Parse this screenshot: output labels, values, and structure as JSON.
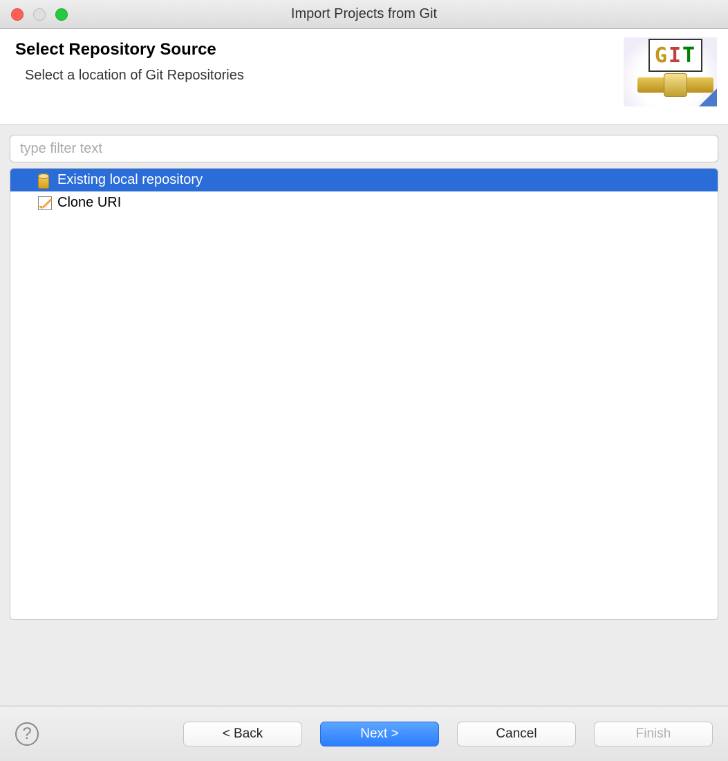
{
  "window": {
    "title": "Import Projects from Git"
  },
  "header": {
    "title": "Select Repository Source",
    "subtitle": "Select a location of Git Repositories"
  },
  "filter": {
    "placeholder": "type filter text",
    "value": ""
  },
  "options": [
    {
      "label": "Existing local repository",
      "selected": true,
      "icon": "database-icon"
    },
    {
      "label": "Clone URI",
      "selected": false,
      "icon": "edit-note-icon"
    }
  ],
  "footer": {
    "back": "< Back",
    "next": "Next >",
    "cancel": "Cancel",
    "finish": "Finish"
  }
}
